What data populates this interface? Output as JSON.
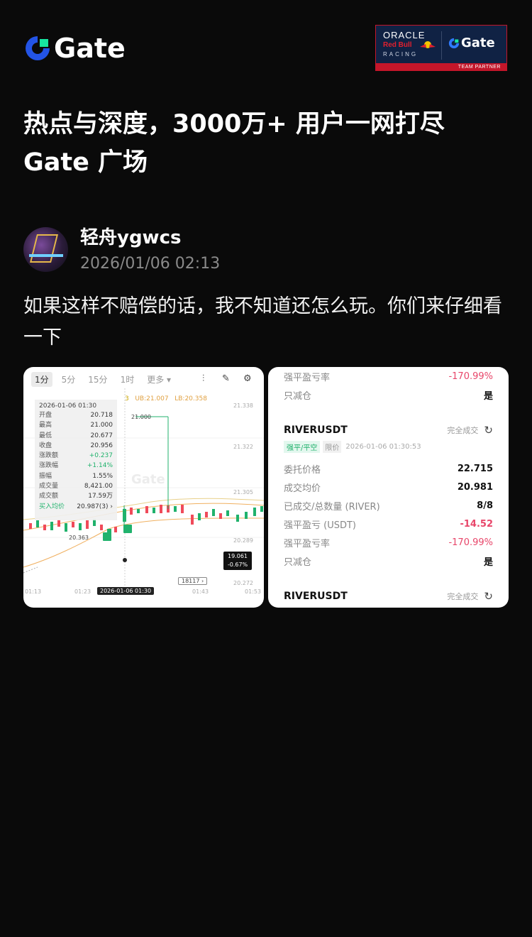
{
  "header": {
    "logo_text": "Gate",
    "partner": {
      "oracle": "ORACLE",
      "redbull": "Red Bull",
      "racing": "RACING",
      "gate": "Gate",
      "team": "TEAM PARTNER"
    },
    "headline_line1": "热点与深度，3000万+ 用户一网打尽",
    "headline_line2": "Gate 广场"
  },
  "post": {
    "username": "轻舟ygwcs",
    "timestamp": "2026/01/06 02:13",
    "text": "如果这样不赔偿的话，我不知道还怎么玩。你们来仔细看一下"
  },
  "chart_card": {
    "tabs": [
      "1分",
      "5分",
      "15分",
      "1时",
      "更多 ▾"
    ],
    "active_tab": 0,
    "ohlc": {
      "date": "2026-01-06 01:30",
      "rows": [
        {
          "label": "开盘",
          "value": "20.718"
        },
        {
          "label": "最高",
          "value": "21.000"
        },
        {
          "label": "最低",
          "value": "20.677"
        },
        {
          "label": "收盘",
          "value": "20.956"
        },
        {
          "label": "涨跌额",
          "value": "+0.237"
        },
        {
          "label": "涨跌幅",
          "value": "+1.14%"
        },
        {
          "label": "振幅",
          "value": "1.55%"
        },
        {
          "label": "成交量",
          "value": "8,421.00"
        },
        {
          "label": "成交额",
          "value": "17.59万"
        }
      ],
      "buy_avg_label": "买入均价",
      "buy_avg_value": "20.987(3) ›"
    },
    "ma_text": "3",
    "ub": "UB:21.007",
    "lb": "LB:20.358",
    "high_marker": "21.000",
    "low_marker": "20.363",
    "axis_labels": [
      "21.338",
      "21.322",
      "21.305",
      "20.289",
      "20.272"
    ],
    "last_price": "19.061",
    "last_change": "-0.67%",
    "date_tag": "2026-01-06 01:30",
    "volume_tag": "18117 ›",
    "time_ticks": [
      "01:13",
      "01:23",
      "01:43",
      "01:53"
    ],
    "watermark": "Gate"
  },
  "order_card": {
    "top_rows": [
      {
        "label": "强平盈亏率",
        "value": "-170.99%",
        "style": "red"
      },
      {
        "label": "只减仓",
        "value": "是",
        "style": "bold"
      }
    ],
    "order1": {
      "symbol": "RIVERUSDT",
      "status": "完全成交",
      "tag1": "强平/平空",
      "tag2": "限价",
      "time": "2026-01-06 01:30:53",
      "rows": [
        {
          "label": "委托价格",
          "value": "22.715",
          "style": "bold"
        },
        {
          "label": "成交均价",
          "value": "20.981",
          "style": "bold"
        },
        {
          "label": "已成交/总数量 (RIVER)",
          "value": "8/8",
          "style": "bold"
        },
        {
          "label": "强平盈亏 (USDT)",
          "value": "-14.52",
          "style": "darkred"
        },
        {
          "label": "强平盈亏率",
          "value": "-170.99%",
          "style": "red"
        },
        {
          "label": "只减仓",
          "value": "是",
          "style": "bold"
        }
      ]
    },
    "order2": {
      "symbol": "RIVERUSDT",
      "status": "完全成交"
    }
  }
}
